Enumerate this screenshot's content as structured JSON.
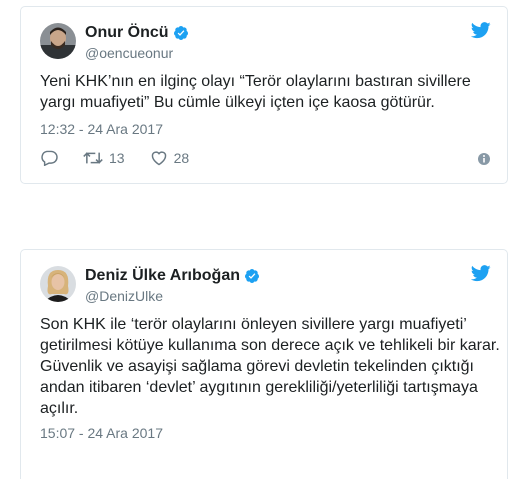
{
  "tweets": [
    {
      "name": "Onur Öncü",
      "handle": "@oencueonur",
      "text": "Yeni KHK’nın en ilginç olayı “Terör olaylarını bastıran sivillere yargı muafiyeti” Bu cümle ülkeyi içten içe kaosa götürür.",
      "timestamp": "12:32 - 24 Ara 2017",
      "retweets": "13",
      "likes": "28",
      "verified": true
    },
    {
      "name": "Deniz Ülke Arıboğan",
      "handle": "@DenizUlke",
      "text": "Son KHK ile ‘terör olaylarını önleyen sivillere yargı muafiyeti’ getirilmesi kötüye kullanıma son derece açık ve tehlikeli bir karar. Güvenlik ve asayişi sağlama görevi devletin tekelinden çıktığı andan itibaren ‘devlet’ aygıtının gerekliliği/yeterliliği tartışmaya açılır.",
      "timestamp": "15:07 - 24 Ara 2017",
      "verified": true
    }
  ],
  "colors": {
    "twitter_blue": "#1da1f2",
    "like_heart": "#697882",
    "meta_gray": "#697882",
    "border": "#e1e8ed"
  },
  "icons": [
    "twitter-bird-icon",
    "verified-badge-icon",
    "reply-icon",
    "retweet-icon",
    "like-icon",
    "info-icon"
  ]
}
